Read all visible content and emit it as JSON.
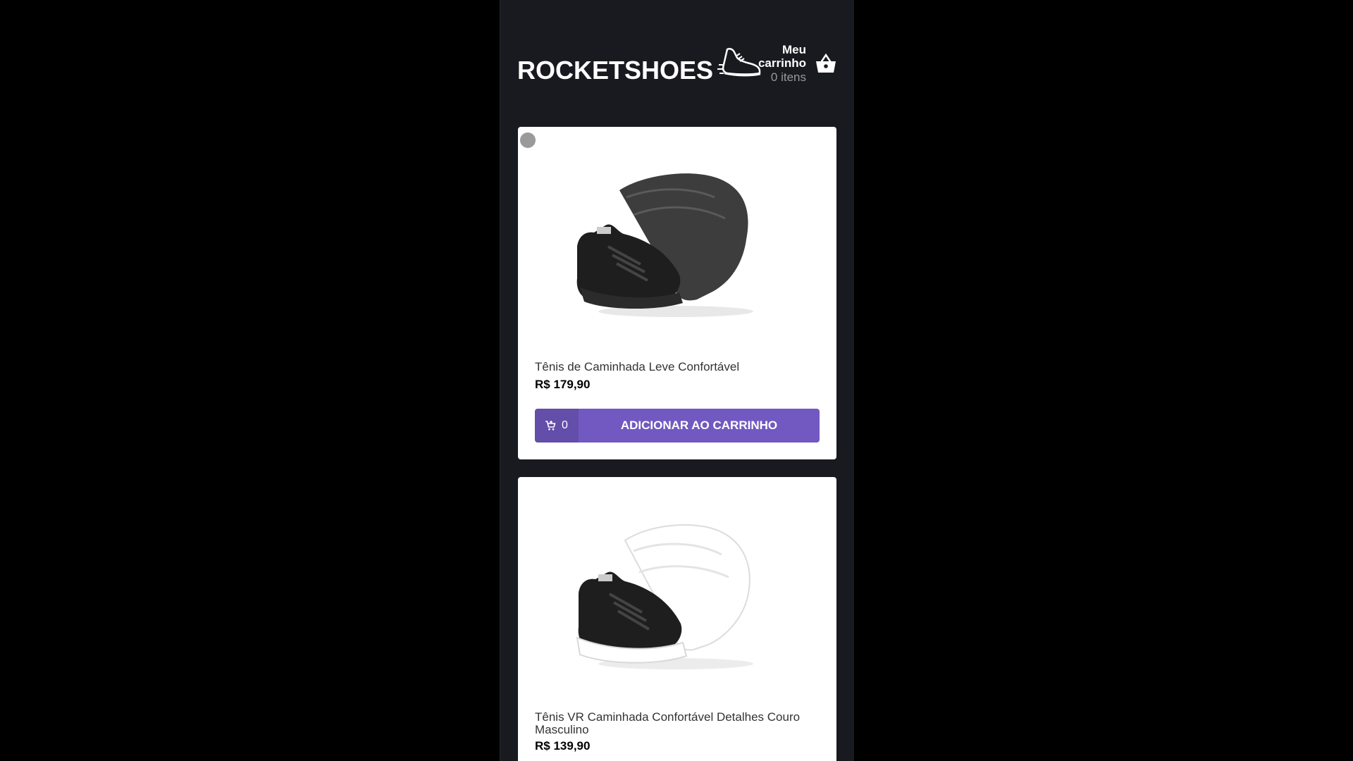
{
  "header": {
    "brand": "ROCKETSHOES",
    "cart_title": "Meu carrinho",
    "cart_count": "0 itens"
  },
  "products": [
    {
      "title": "Tênis de Caminhada Leve Confortável",
      "price": "R$ 179,90",
      "cart_amount": "0",
      "button_label": "ADICIONAR AO CARRINHO",
      "image": "black-sneaker-black-sole"
    },
    {
      "title": "Tênis VR Caminhada Confortável Detalhes Couro Masculino",
      "price": "R$ 139,90",
      "image": "black-sneaker-white-sole"
    }
  ],
  "colors": {
    "background": "#191920",
    "accent": "#7159c1",
    "card": "#ffffff"
  },
  "icons": [
    "shoe-logo-icon",
    "basket-icon",
    "add-cart-icon",
    "loading-icon"
  ]
}
